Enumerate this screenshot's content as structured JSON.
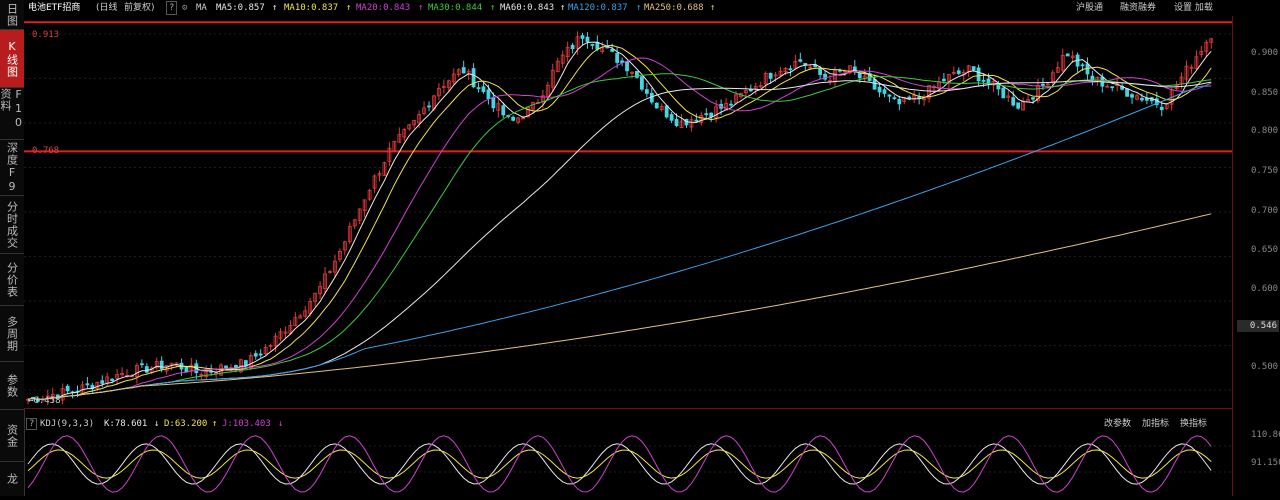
{
  "sidebar": {
    "tabs": [
      {
        "label": "日图",
        "active": false
      },
      {
        "label": "K线图",
        "active": true
      },
      {
        "label": "F10资料",
        "active": false
      },
      {
        "label": "深度F9",
        "active": false
      },
      {
        "label": "分时成交",
        "active": false
      },
      {
        "label": "分价表",
        "active": false
      },
      {
        "label": "多周期",
        "active": false
      },
      {
        "label": "参数",
        "active": false
      },
      {
        "label": "资金",
        "active": false
      },
      {
        "label": "龙",
        "active": false
      }
    ]
  },
  "topbar": {
    "title": "电池ETF招商",
    "period": "(日线",
    "adjust": "前复权)",
    "ma_label": "MA",
    "ma": [
      {
        "label": "MA5:0.857",
        "color": "#e8e8e8"
      },
      {
        "label": "MA10:0.837",
        "color": "#f2e14c"
      },
      {
        "label": "MA20:0.843",
        "color": "#d040d0"
      },
      {
        "label": "MA30:0.844",
        "color": "#3ec83e"
      },
      {
        "label": "MA60:0.843",
        "color": "#e8e8e8"
      },
      {
        "label": "MA120:0.837",
        "color": "#3aa0e8"
      },
      {
        "label": "MA250:0.688",
        "color": "#e0c080"
      }
    ],
    "right_items": [
      "沪股通",
      "融资融券",
      "设置 加载"
    ]
  },
  "price_axis": {
    "labels": [
      "0.900",
      "0.850",
      "0.800",
      "0.750",
      "0.700",
      "0.650",
      "0.600",
      "0.550",
      "0.500"
    ],
    "current": "0.546"
  },
  "levels": {
    "upper": "0.913",
    "lower": "0.768",
    "low_mark": "0.458"
  },
  "indicator": {
    "name": "KDJ(9,3,3)",
    "k": "K:78.601",
    "d": "D:63.200",
    "j": "J:103.403",
    "right_items": [
      "改参数",
      "加指标",
      "换指标"
    ],
    "axis_labels": [
      "110.860",
      "91.150"
    ]
  },
  "chart_data": {
    "type": "candlestick",
    "title": "电池ETF招商",
    "ylim": [
      0.48,
      0.92
    ],
    "horizontal_lines": [
      0.913,
      0.768
    ],
    "moving_averages": [
      {
        "name": "MA5",
        "last": 0.857,
        "color": "#e8e8e8"
      },
      {
        "name": "MA10",
        "last": 0.837,
        "color": "#f2e14c"
      },
      {
        "name": "MA20",
        "last": 0.843,
        "color": "#d040d0"
      },
      {
        "name": "MA30",
        "last": 0.844,
        "color": "#3ec83e"
      },
      {
        "name": "MA60",
        "last": 0.843,
        "color": "#e8e8e8"
      },
      {
        "name": "MA120",
        "last": 0.837,
        "color": "#3aa0e8"
      },
      {
        "name": "MA250",
        "last": 0.688,
        "color": "#e0c080"
      }
    ],
    "price_path": [
      0.49,
      0.495,
      0.5,
      0.51,
      0.52,
      0.525,
      0.53,
      0.52,
      0.525,
      0.53,
      0.55,
      0.58,
      0.61,
      0.66,
      0.72,
      0.77,
      0.8,
      0.84,
      0.86,
      0.83,
      0.8,
      0.82,
      0.87,
      0.9,
      0.88,
      0.86,
      0.82,
      0.8,
      0.81,
      0.82,
      0.84,
      0.86,
      0.87,
      0.85,
      0.86,
      0.84,
      0.82,
      0.83,
      0.85,
      0.86,
      0.84,
      0.82,
      0.84,
      0.88,
      0.85,
      0.84,
      0.83,
      0.82,
      0.86,
      0.9
    ]
  }
}
